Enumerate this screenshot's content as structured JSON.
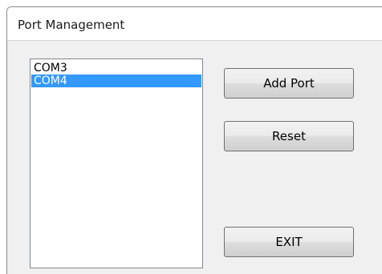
{
  "window": {
    "title": "Port Management"
  },
  "port_list": {
    "items": [
      {
        "label": "COM3",
        "selected": false
      },
      {
        "label": "COM4",
        "selected": true
      }
    ]
  },
  "buttons": {
    "add_port": "Add Port",
    "reset": "Reset",
    "exit": "EXIT"
  },
  "colors": {
    "selection": "#3399ff",
    "window_background": "#f0f0f0"
  }
}
